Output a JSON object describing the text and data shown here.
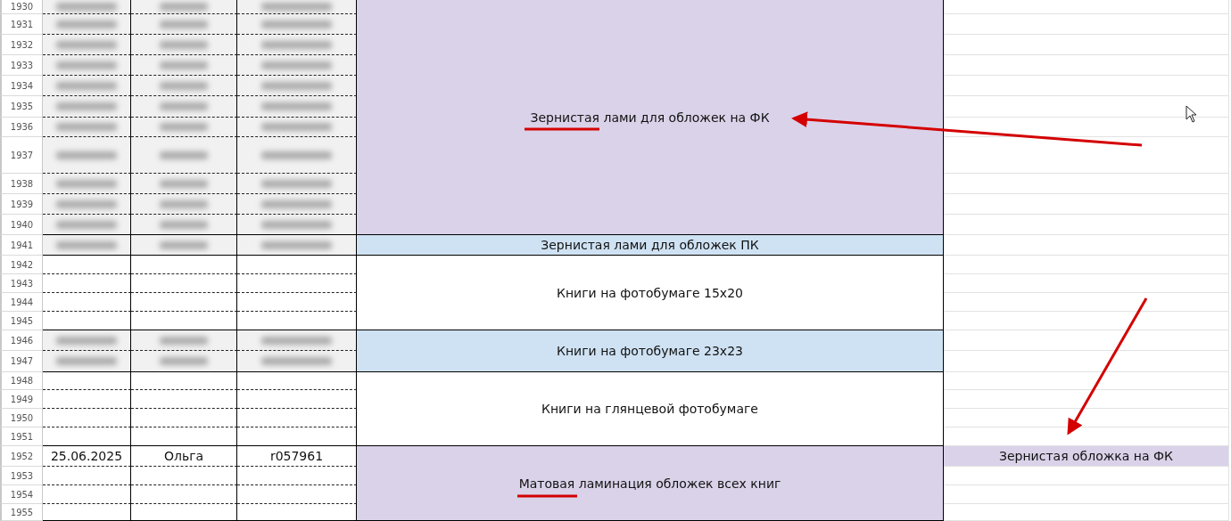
{
  "groups": [
    {
      "label": "Зернистая лами для обложек на ФК",
      "color": "#dad2e9",
      "rows": [
        {
          "number": "1930",
          "blurred": true
        },
        {
          "number": "1931",
          "blurred": true
        },
        {
          "number": "1932",
          "blurred": true
        },
        {
          "number": "1933",
          "blurred": true
        },
        {
          "number": "1934",
          "blurred": true
        },
        {
          "number": "1935",
          "blurred": true
        },
        {
          "number": "1936",
          "blurred": true
        },
        {
          "number": "1937",
          "blurred": true
        },
        {
          "number": "1938",
          "blurred": true
        },
        {
          "number": "1939",
          "blurred": true
        },
        {
          "number": "1940",
          "blurred": true
        }
      ]
    },
    {
      "label": "Зернистая лами для обложек ПК",
      "color": "#cfe2f3",
      "rows": [
        {
          "number": "1941",
          "blurred": true
        }
      ]
    },
    {
      "label": "Книги на фотобумаге 15х20",
      "color": "#ffffff",
      "rows": [
        {
          "number": "1942",
          "blurred": false
        },
        {
          "number": "1943",
          "blurred": false
        },
        {
          "number": "1944",
          "blurred": false
        },
        {
          "number": "1945",
          "blurred": false
        }
      ]
    },
    {
      "label": "Книги на фотобумаге 23х23",
      "color": "#cfe2f3",
      "rows": [
        {
          "number": "1946",
          "blurred": true
        },
        {
          "number": "1947",
          "blurred": true
        }
      ]
    },
    {
      "label": "Книги на глянцевой фотобумаге",
      "color": "#ffffff",
      "rows": [
        {
          "number": "1948",
          "blurred": false
        },
        {
          "number": "1949",
          "blurred": false
        },
        {
          "number": "1950",
          "blurred": false
        },
        {
          "number": "1951",
          "blurred": false
        }
      ]
    },
    {
      "label": "Матовая ламинация обложек всех книг",
      "color": "#dad2e9",
      "rows": [
        {
          "number": "1952",
          "blurred": false,
          "cells": [
            "25.06.2025",
            "Ольга",
            "r057961"
          ],
          "note": {
            "text": "Зернистая обложка на ФК",
            "color": "#dad2e9"
          }
        },
        {
          "number": "1953",
          "blurred": false
        },
        {
          "number": "1954",
          "blurred": false
        },
        {
          "number": "1955",
          "blurred": false
        }
      ]
    }
  ]
}
